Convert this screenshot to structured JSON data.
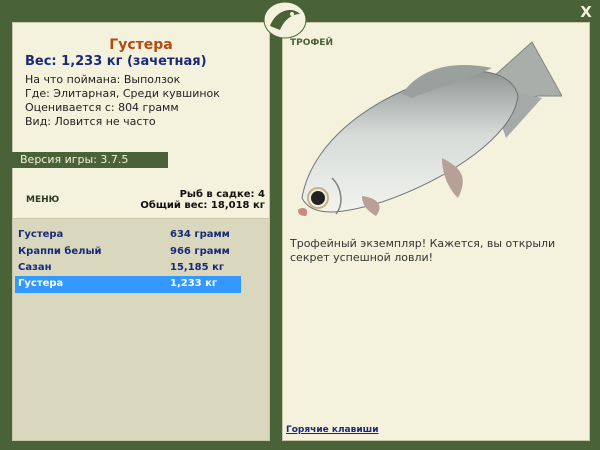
{
  "fish": {
    "name": "Густера",
    "weight": "Вес: 1,233 кг (зачетная)",
    "bait": "На что поймана: Выползок",
    "location": "Где: Элитарная, Среди кувшинок",
    "valued_from": "Оценивается с: 804 грамм",
    "frequency": "Вид: Ловится не часто"
  },
  "version": "Версия игры: 3.7.5",
  "menu_label": "МЕНЮ",
  "keepnet": {
    "count": "Рыб в садке: 4",
    "total": "Общий вес: 18,018 кг"
  },
  "catch_list": [
    {
      "name": "Густера",
      "weight": "634 грамм"
    },
    {
      "name": "Краппи белый",
      "weight": "966 грамм"
    },
    {
      "name": "Сазан",
      "weight": "15,185 кг"
    },
    {
      "name": "Густера",
      "weight": "1,233 кг"
    }
  ],
  "selected_index": 3,
  "trophy": {
    "label": "ТРОФЕЙ",
    "text": "Трофейный экземпляр! Кажется, вы открыли секрет успешной ловли!"
  },
  "hotkeys": "Горячие клавиши",
  "close_label": "X",
  "colors": {
    "frame": "#4a6238",
    "panel": "#f4f2dc",
    "title": "#b54a12",
    "text_blue": "#1a2a78",
    "selected": "#3399ff"
  },
  "icons": {
    "logo": "fish-logo-icon",
    "close": "close-icon"
  }
}
